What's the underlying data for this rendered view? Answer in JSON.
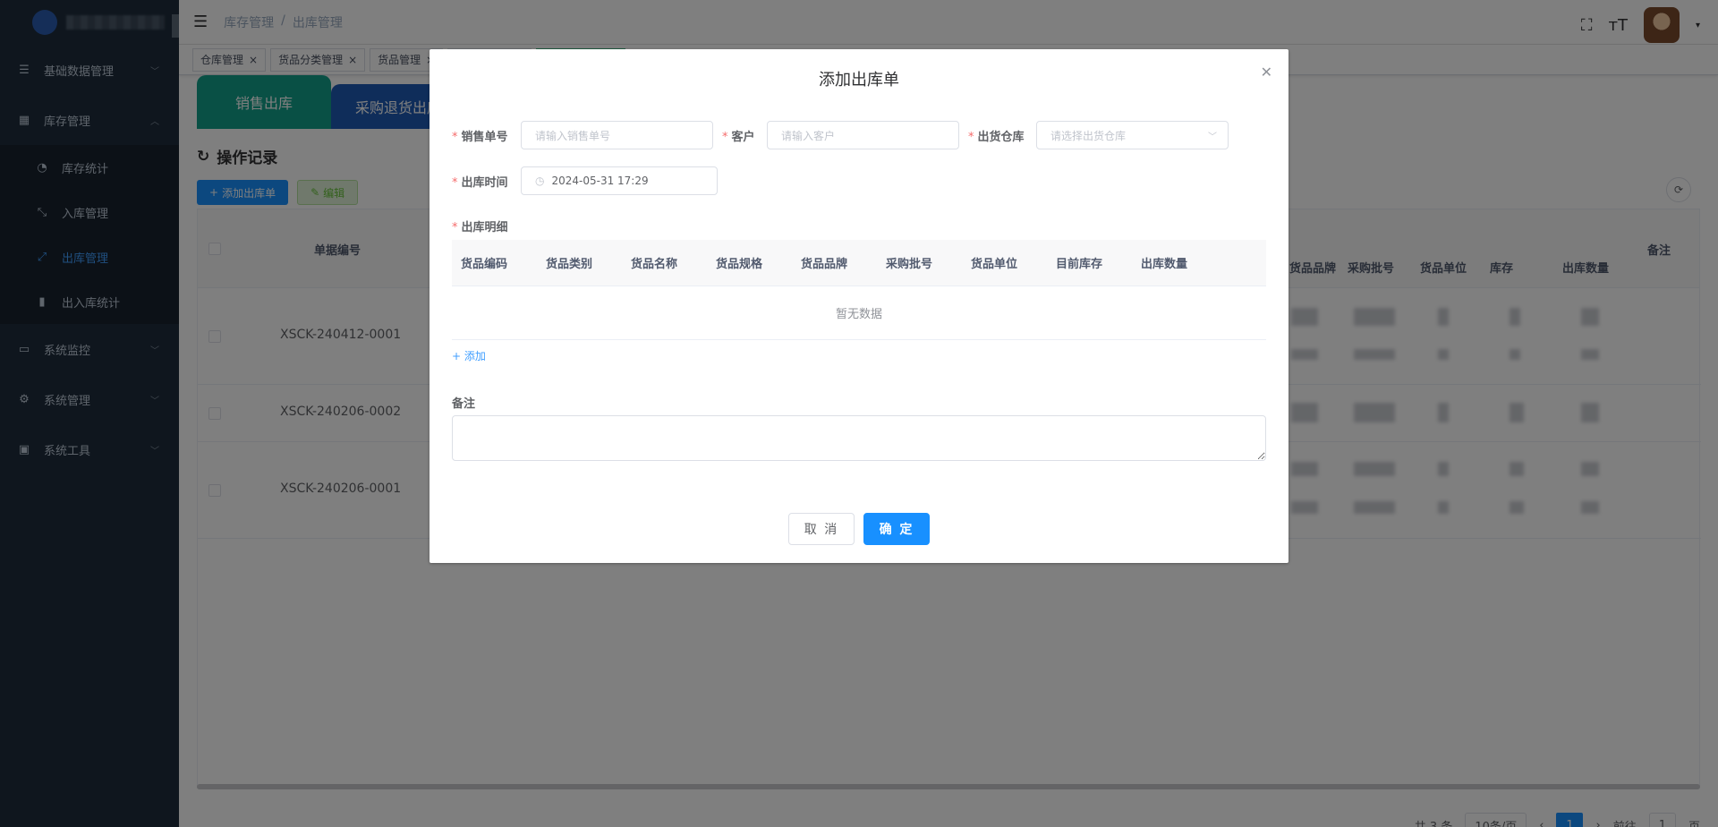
{
  "sidebar": {
    "items": [
      {
        "label": "基础数据管理",
        "icon": "list-icon"
      },
      {
        "label": "库存管理",
        "icon": "table-icon",
        "expanded": true
      },
      {
        "label": "系统监控",
        "icon": "monitor-icon"
      },
      {
        "label": "系统管理",
        "icon": "gear-icon"
      },
      {
        "label": "系统工具",
        "icon": "toolbox-icon"
      }
    ],
    "sub_items": [
      {
        "label": "库存统计",
        "icon": "dashboard-icon"
      },
      {
        "label": "入库管理",
        "icon": "inbound-icon"
      },
      {
        "label": "出库管理",
        "icon": "outbound-icon",
        "active": true
      },
      {
        "label": "出入库统计",
        "icon": "bar-chart-icon"
      }
    ]
  },
  "navbar": {
    "breadcrumb": [
      "库存管理",
      "/",
      "出库管理"
    ]
  },
  "tags": [
    "仓库管理",
    "货品分类管理",
    "货品管理"
  ],
  "page": {
    "tabs": [
      "销售出库",
      "采购退货出库"
    ],
    "section_title": "操作记录",
    "add_button": "添加出库单",
    "edit_button": "编辑",
    "table_headers": {
      "code": "单据编号",
      "brand": "货品品牌",
      "batch": "采购批号",
      "unit": "货品单位",
      "stock": "库存",
      "qty": "出库数量",
      "remark": "备注"
    },
    "rows": [
      "XSCK-240412-0001",
      "XSCK-240206-0002",
      "XSCK-240206-0001"
    ],
    "pagination": {
      "total": "共 3 条",
      "page_size": "10条/页",
      "current": "1",
      "goto": "前往",
      "goto_value": "1",
      "page_suffix": "页"
    }
  },
  "dialog": {
    "title": "添加出库单",
    "sales_no_label": "销售单号",
    "sales_no_placeholder": "请输入销售单号",
    "customer_label": "客户",
    "customer_placeholder": "请输入客户",
    "warehouse_label": "出货仓库",
    "warehouse_placeholder": "请选择出货仓库",
    "time_label": "出库时间",
    "time_value": "2024-05-31 17:29",
    "detail_label": "出库明细",
    "detail_headers": [
      "货品编码",
      "货品类别",
      "货品名称",
      "货品规格",
      "货品品牌",
      "采购批号",
      "货品单位",
      "目前库存",
      "出库数量"
    ],
    "empty_text": "暂无数据",
    "add_link": "添加",
    "remark_label": "备注",
    "cancel": "取 消",
    "confirm": "确 定"
  },
  "colors": {
    "sidebar_bg": "#1f2d3d",
    "primary": "#1890ff",
    "active_menu": "#409eff",
    "tab_green": "#13a08a",
    "tab_blue": "#1e5bb5",
    "required": "#f56c6c"
  }
}
